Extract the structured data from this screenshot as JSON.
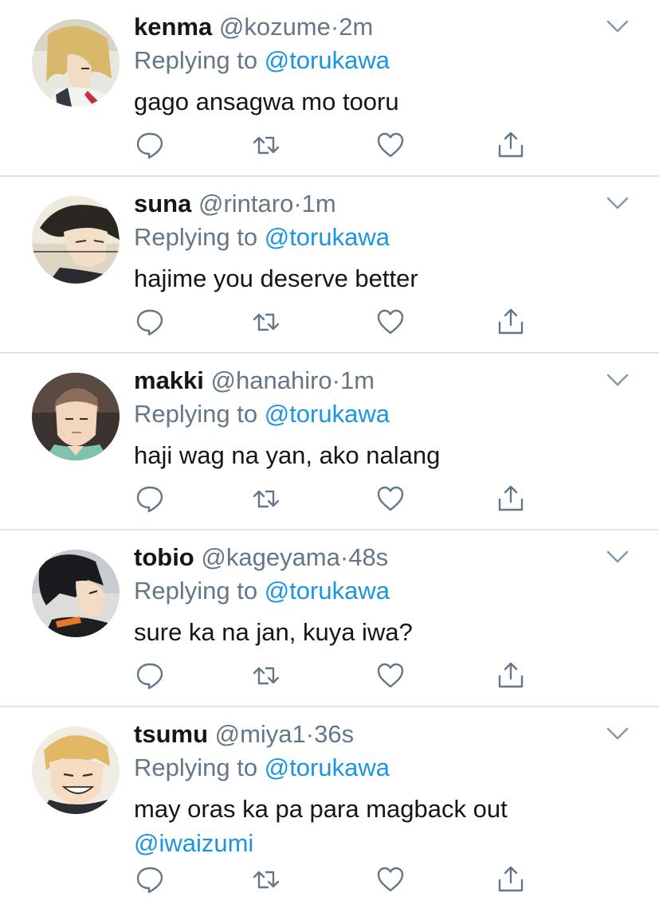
{
  "tweets": [
    {
      "name": "kenma",
      "handle": "@kozume",
      "separator": "·",
      "time": "2m",
      "replying_prefix": "Replying to",
      "replying_to": "@torukawa",
      "text": "gago ansagwa mo tooru",
      "avatar_icon": "blonde-character-avatar"
    },
    {
      "name": "suna",
      "handle": "@rintaro",
      "separator": "·",
      "time": "1m",
      "replying_prefix": "Replying to",
      "replying_to": "@torukawa",
      "text": "hajime you deserve better",
      "avatar_icon": "dark-haired-character-avatar"
    },
    {
      "name": "makki",
      "handle": "@hanahiro",
      "separator": "·",
      "time": "1m",
      "replying_prefix": "Replying to",
      "replying_to": "@torukawa",
      "text": "haji wag na yan, ako nalang",
      "avatar_icon": "short-haired-character-avatar"
    },
    {
      "name": "tobio",
      "handle": "@kageyama",
      "separator": "·",
      "time": "48s",
      "replying_prefix": "Replying to",
      "replying_to": "@torukawa",
      "text": "sure ka na jan, kuya iwa?",
      "avatar_icon": "black-haired-character-avatar"
    },
    {
      "name": "tsumu",
      "handle": "@miya1",
      "separator": "·",
      "time": "36s",
      "replying_prefix": "Replying to",
      "replying_to": "@torukawa",
      "text": "may oras ka pa para magback out",
      "text_mention": "@iwaizumi",
      "avatar_icon": "grinning-blonde-character-avatar"
    }
  ],
  "colors": {
    "text": "#14171a",
    "secondary": "#657786",
    "link": "#1b95e0",
    "divider": "#dfe3e7"
  },
  "icons": [
    "reply-icon",
    "retweet-icon",
    "like-icon",
    "share-icon",
    "chevron-down-icon"
  ]
}
